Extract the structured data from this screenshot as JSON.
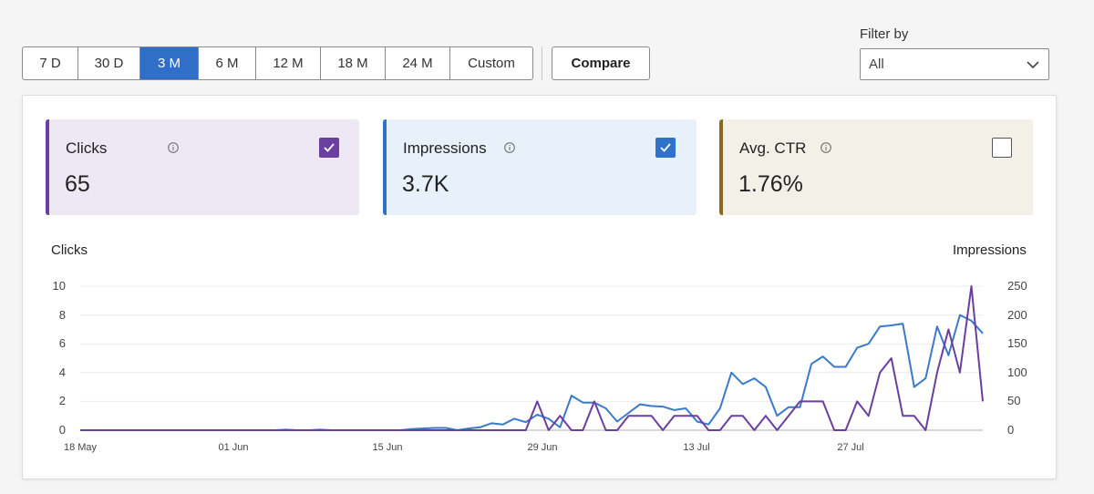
{
  "toolbar": {
    "ranges": [
      "7 D",
      "30 D",
      "3 M",
      "6 M",
      "12 M",
      "18 M",
      "24 M",
      "Custom"
    ],
    "active_range": "3 M",
    "compare_label": "Compare"
  },
  "filter": {
    "label": "Filter by",
    "value": "All",
    "icon": "chevron-down-icon"
  },
  "metrics": [
    {
      "title": "Clicks",
      "value": "65",
      "checked": true,
      "accent": "#6b3fa0",
      "bg": "#eee8f4",
      "check_bg": "#6b3fa0"
    },
    {
      "title": "Impressions",
      "value": "3.7K",
      "checked": true,
      "accent": "#2f72c9",
      "bg": "#e8f0fa",
      "check_bg": "#2f72c9"
    },
    {
      "title": "Avg. CTR",
      "value": "1.76%",
      "checked": false,
      "accent": "#8a6a1e",
      "bg": "#f3f0e8",
      "check_bg": "#ffffff"
    }
  ],
  "chart_data": {
    "type": "line",
    "left_axis_title": "Clicks",
    "right_axis_title": "Impressions",
    "left_ticks": [
      "10",
      "8",
      "6",
      "4",
      "2",
      "0"
    ],
    "right_ticks": [
      "250",
      "200",
      "150",
      "100",
      "50",
      "0"
    ],
    "ylim_left": [
      0,
      10
    ],
    "ylim_right": [
      0,
      250
    ],
    "x_tick_labels": [
      "18 May",
      "01 Jun",
      "15 Jun",
      "29 Jun",
      "13 Jul",
      "27 Jul"
    ],
    "grid": true,
    "series": [
      {
        "name": "Impressions",
        "axis": "right",
        "color": "#3a7ac9",
        "values": [
          0,
          0,
          0,
          0,
          0,
          0,
          0,
          0,
          0,
          0,
          0,
          0,
          0,
          0,
          0,
          0,
          0,
          0,
          1,
          0,
          0,
          1,
          0,
          0,
          0,
          0,
          0,
          0,
          0,
          2,
          3,
          4,
          4,
          0,
          3,
          5,
          12,
          10,
          20,
          14,
          27,
          20,
          5,
          60,
          48,
          48,
          38,
          15,
          30,
          45,
          42,
          41,
          35,
          38,
          15,
          10,
          38,
          100,
          80,
          90,
          75,
          25,
          40,
          40,
          115,
          128,
          110,
          110,
          143,
          150,
          180,
          182,
          185,
          75,
          90,
          180,
          130,
          200,
          190,
          168
        ]
      },
      {
        "name": "Clicks",
        "axis": "left",
        "color": "#6b3fa0",
        "values": [
          0,
          0,
          0,
          0,
          0,
          0,
          0,
          0,
          0,
          0,
          0,
          0,
          0,
          0,
          0,
          0,
          0,
          0,
          0,
          0,
          0,
          0,
          0,
          0,
          0,
          0,
          0,
          0,
          0,
          0,
          0,
          0,
          0,
          0,
          0,
          0,
          0,
          0,
          0,
          0,
          2,
          0,
          1,
          0,
          0,
          2,
          0,
          0,
          1,
          1,
          1,
          0,
          1,
          1,
          1,
          0,
          0,
          1,
          1,
          0,
          1,
          0,
          1,
          2,
          2,
          2,
          0,
          0,
          2,
          1,
          4,
          5,
          1,
          1,
          0,
          4,
          7,
          4,
          10,
          2
        ]
      }
    ]
  }
}
